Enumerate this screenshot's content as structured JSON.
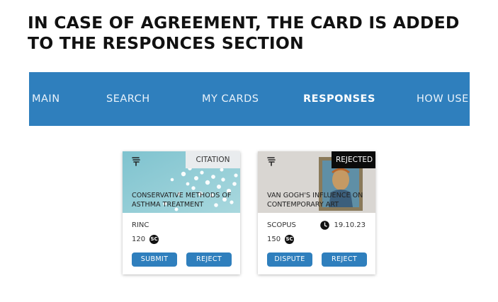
{
  "headline": "IN CASE OF AGREEMENT, THE CARD IS ADDED TO THE RESPONCES SECTION",
  "nav": {
    "items": [
      {
        "label": "MAIN",
        "active": false
      },
      {
        "label": "SEARCH",
        "active": false
      },
      {
        "label": "MY CARDS",
        "active": false
      },
      {
        "label": "RESPONSES",
        "active": true
      },
      {
        "label": "HOW USE",
        "active": false
      }
    ]
  },
  "cards": [
    {
      "badge": "CITATION",
      "title": "CONSERVATIVE METHODS OF ASTHMA TREATMENT",
      "source": "RINC",
      "price": "120",
      "coin_symbol": "SC",
      "buttons": [
        "SUBMIT",
        "REJECT"
      ]
    },
    {
      "badge": "REJECTED",
      "title": "VAN GOGH'S INFLUENCE ON CONTEMPORARY ART",
      "source": "SCOPUS",
      "date": "19.10.23",
      "price": "150",
      "coin_symbol": "SC",
      "buttons": [
        "DISPUTE",
        "REJECT"
      ]
    }
  ],
  "colors": {
    "accent": "#2f7fbd",
    "badge_rejected_bg": "#0b0b0b",
    "badge_citation_bg": "#e9ecee"
  },
  "icons": [
    "tag-icon",
    "clock-icon",
    "coin-icon"
  ]
}
